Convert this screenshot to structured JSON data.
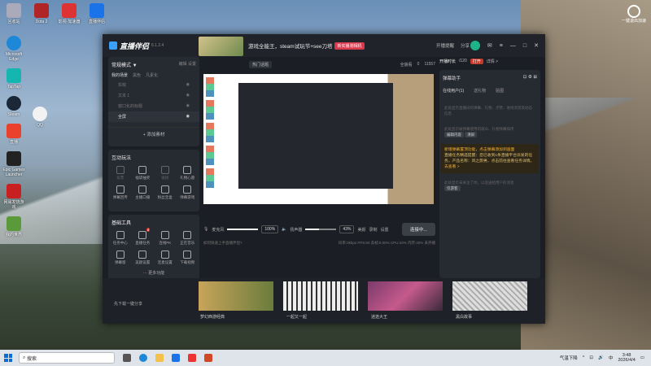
{
  "desktop": {
    "left_icons": [
      {
        "label": "Microsoft Edge",
        "color": "#1e88d8"
      },
      {
        "label": "TapTap",
        "color": "#16b6b0"
      },
      {
        "label": "Steam",
        "color": "#1b2838"
      },
      {
        "label": "QQ",
        "color": "#f2f2f2"
      },
      {
        "label": "直播",
        "color": "#e9412b"
      },
      {
        "label": "Epic Games Launcher",
        "color": "#222"
      },
      {
        "label": "网易发烧游戏",
        "color": "#c82020"
      },
      {
        "label": "我的世界",
        "color": "#5a9a3a"
      }
    ],
    "top_icons": [
      {
        "label": "回收站",
        "color": "#aab"
      },
      {
        "label": "Dota 2",
        "color": "#b02525"
      },
      {
        "label": "影视-加速器",
        "color": "#d33"
      },
      {
        "label": "直播伴侣",
        "color": "#1a73e8"
      }
    ],
    "right_icon": {
      "label": "一键退出加速"
    }
  },
  "app": {
    "name": "直播伴侣",
    "version": "6.1.2.4",
    "stream_title": "游戏全能王，steam试玩节+see刀塔",
    "title_badge": "新实播测相机",
    "actions": [
      "开播提醒",
      "分享"
    ],
    "left": {
      "mode_label": "常规模式 ▼",
      "mode_actions": [
        "编辑",
        "设置"
      ],
      "scene_tabs": [
        "我的场景",
        "黑色",
        "凡素化"
      ],
      "sources": [
        "东皖",
        "文本 1",
        "窗口化的标题",
        "全屏"
      ],
      "add_source": "+ 添加素材",
      "interact_title": "互动玩法",
      "interact_items": [
        "投票",
        "福袋抽奖",
        "链接",
        "礼物心愿",
        "弹幕回传",
        "主播口播",
        "粉丝宝盒",
        "弹幕游戏"
      ],
      "basic_title": "基础工具",
      "basic_items": [
        "任务中心",
        "直播任务",
        "连线PK",
        "正在音乐",
        "弹幕窗",
        "美颜设置",
        "连麦设置",
        "下载视频"
      ],
      "basic_badge": "8",
      "more_label": "··· 更多功能"
    },
    "center": {
      "hot_label": "热门话题",
      "right_items": [
        "全貌看",
        "0",
        "11557"
      ],
      "mic_label": "麦克风",
      "mic_pct": "100%",
      "speaker_label": "扬声器",
      "speaker_pct": "43%",
      "tool_labels": [
        "美颜",
        "录制",
        "设置"
      ],
      "go_live": "连接中...",
      "status_left": "如何快速上手直播伴侣?",
      "status_right": [
        "码率:0kbps",
        "FPS:60",
        "丢帧:0.00%",
        "CPU:43%",
        "内存:40%",
        "未开播"
      ]
    },
    "right": {
      "tab_label": "开播时长",
      "tab_count": "/120",
      "badge": "打开",
      "tab_extra": "详情 >",
      "assistant_title": "弹幕助手",
      "subtabs": [
        "在线用户(1)",
        "送礼物",
        "贴图"
      ],
      "card1": "此处显示直播间的弹幕、礼物、点赞、进场消息及动态信息",
      "card2": "此处显示被弹幕使用的观众、礼物弹幕排序",
      "card2_btns": [
        "编辑内容",
        "清屏"
      ],
      "notice1": "新增弹幕置顶功能，点击弹幕添加到画面",
      "notice2": "直播任务精选提醒：您已收到1条直播平台派发的任务，产品名称：风之旅男，点击前往查看任务详情。",
      "notice_link": "去查看 >",
      "card3": "此处显示未关注了你，以及送给用户的消息",
      "card3_btn": "仅游客"
    },
    "bottom": {
      "download": "先下载一键分享",
      "items": [
        "梦幻西游经典",
        "一起又一起",
        "迷途大王",
        "黑白故事"
      ]
    }
  },
  "taskbar": {
    "search_placeholder": "搜索",
    "weather": "气温下降",
    "time": "3:48",
    "date": "2026/4/4",
    "lang": "中"
  }
}
